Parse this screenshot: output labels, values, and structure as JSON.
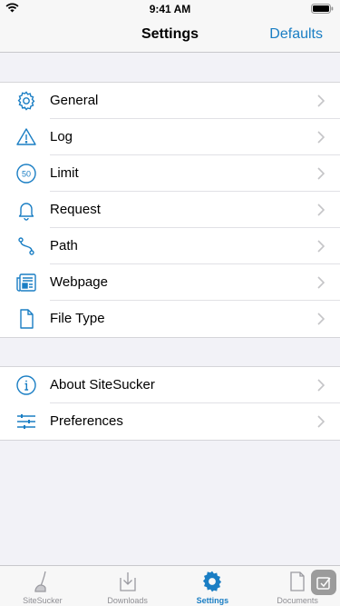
{
  "status_bar": {
    "time": "9:41 AM"
  },
  "nav": {
    "title": "Settings",
    "right_button": "Defaults"
  },
  "colors": {
    "accent": "#1a7ec4",
    "background": "#f2f2f7",
    "tab_inactive": "#8e8e93"
  },
  "settings_group_1": [
    {
      "label": "General",
      "icon": "gear-icon"
    },
    {
      "label": "Log",
      "icon": "warning-icon"
    },
    {
      "label": "Limit",
      "icon": "limit-50-icon"
    },
    {
      "label": "Request",
      "icon": "bell-icon"
    },
    {
      "label": "Path",
      "icon": "path-icon"
    },
    {
      "label": "Webpage",
      "icon": "webpage-icon"
    },
    {
      "label": "File Type",
      "icon": "document-icon"
    }
  ],
  "settings_group_2": [
    {
      "label": "About SiteSucker",
      "icon": "info-icon"
    },
    {
      "label": "Preferences",
      "icon": "sliders-icon"
    }
  ],
  "limit_icon_text": "50",
  "tabs": [
    {
      "label": "SiteSucker",
      "icon": "vacuum-icon",
      "active": false
    },
    {
      "label": "Downloads",
      "icon": "download-icon",
      "active": false
    },
    {
      "label": "Settings",
      "icon": "gear-icon",
      "active": true
    },
    {
      "label": "Documents",
      "icon": "documents-icon",
      "active": false
    }
  ]
}
